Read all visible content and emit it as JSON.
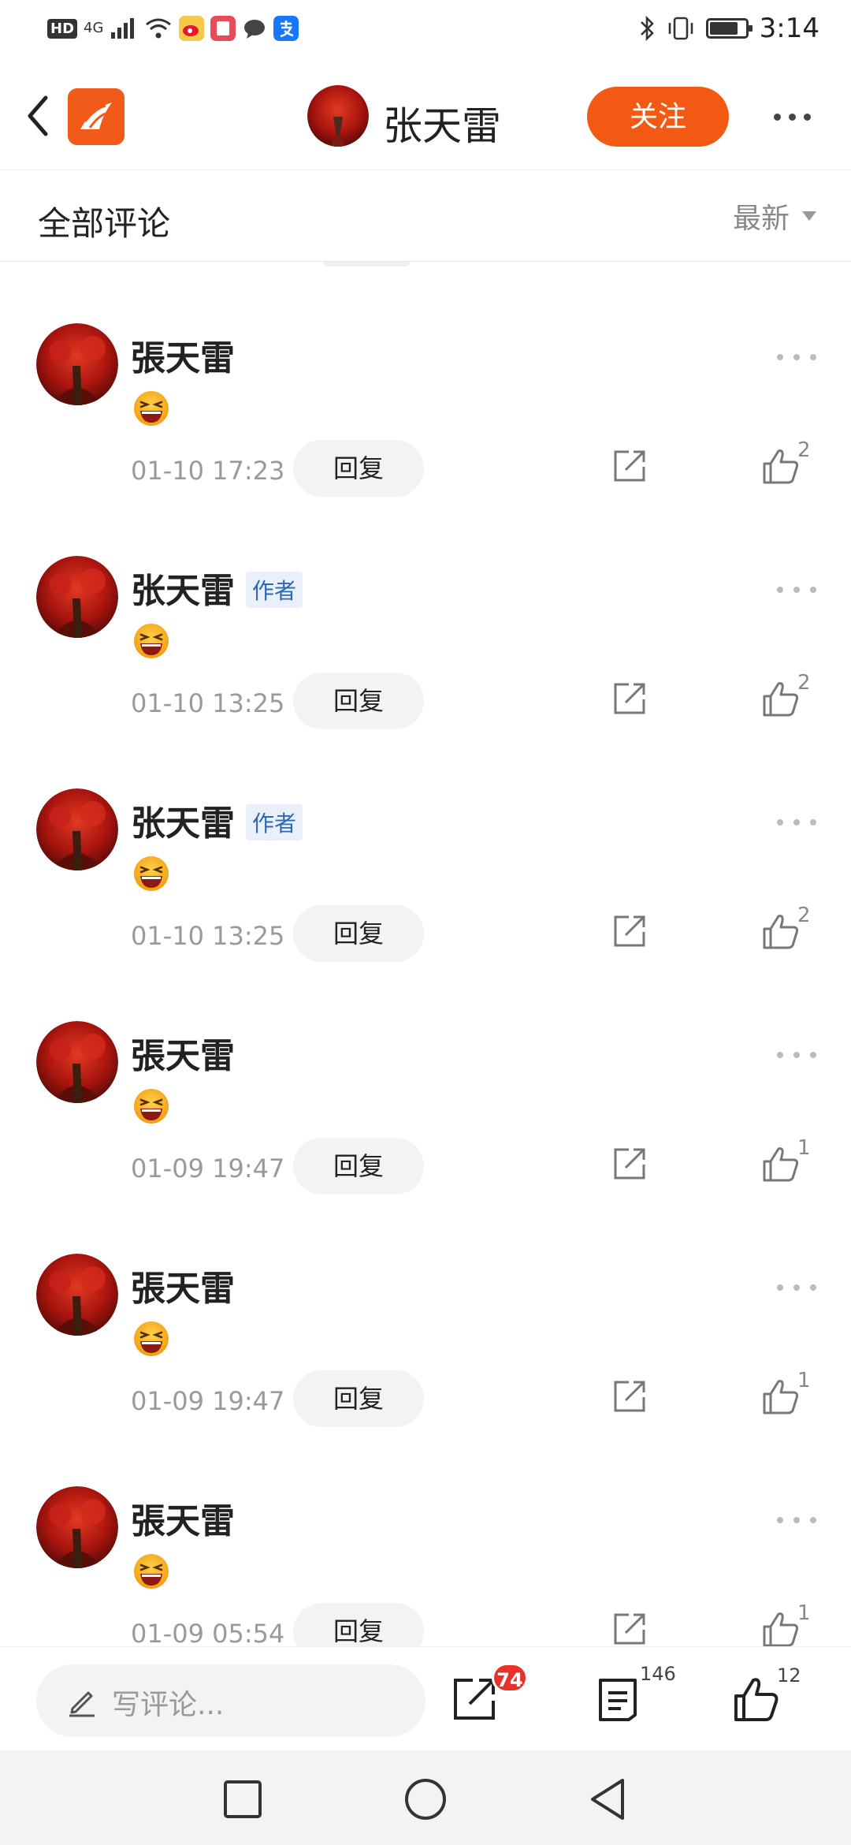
{
  "status_bar": {
    "network_badge": "HD",
    "network_type": "4G",
    "time": "3:14",
    "battery_level": 0.8
  },
  "header": {
    "author_name": "张天雷",
    "follow_label": "关注"
  },
  "section": {
    "title": "全部评论",
    "sort_label": "最新"
  },
  "comments": [
    {
      "name": "張天雷",
      "badge": "",
      "time": "01-10 17:23",
      "reply_label": "回复",
      "likes": "2"
    },
    {
      "name": "张天雷",
      "badge": "作者",
      "time": "01-10 13:25",
      "reply_label": "回复",
      "likes": "2"
    },
    {
      "name": "张天雷",
      "badge": "作者",
      "time": "01-10 13:25",
      "reply_label": "回复",
      "likes": "2"
    },
    {
      "name": "張天雷",
      "badge": "",
      "time": "01-09 19:47",
      "reply_label": "回复",
      "likes": "1"
    },
    {
      "name": "張天雷",
      "badge": "",
      "time": "01-09 19:47",
      "reply_label": "回复",
      "likes": "1"
    },
    {
      "name": "張天雷",
      "badge": "",
      "time": "01-09 05:54",
      "reply_label": "回复",
      "likes": "1"
    }
  ],
  "bottom_bar": {
    "input_placeholder": "写评论...",
    "share_count": "74",
    "comment_count": "146",
    "like_count": "12"
  },
  "colors": {
    "accent": "#f25a14",
    "author_badge": "#2f66b5",
    "notification_badge": "#e8312a"
  }
}
